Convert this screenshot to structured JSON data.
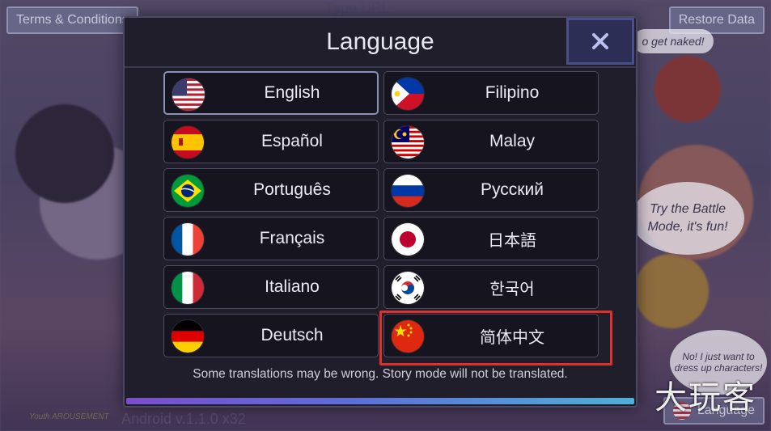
{
  "background": {
    "terms_button": "Terms & Conditions",
    "restore_button": "Restore Data",
    "language_button": "Language",
    "type_url_text": "Type URL:",
    "bubble_naked": "o get naked!",
    "bubble_battle": "Try the Battle Mode, it's fun!",
    "bubble_dress": "No! I just want to dress up characters!",
    "version_text": "Android v.1.1.0 x32",
    "studio_text": "Youth AROUSEMENT"
  },
  "modal": {
    "title": "Language",
    "close_icon": "close-icon",
    "note": "Some translations may be wrong. Story mode will not be translated.",
    "languages": [
      {
        "label": "English",
        "flag": "us-flag-icon",
        "selected": true
      },
      {
        "label": "Filipino",
        "flag": "philippines-flag-icon"
      },
      {
        "label": "Español",
        "flag": "spain-flag-icon"
      },
      {
        "label": "Malay",
        "flag": "malaysia-flag-icon"
      },
      {
        "label": "Português",
        "flag": "brazil-flag-icon"
      },
      {
        "label": "Русский",
        "flag": "russia-flag-icon"
      },
      {
        "label": "Français",
        "flag": "france-flag-icon"
      },
      {
        "label": "日本語",
        "flag": "japan-flag-icon"
      },
      {
        "label": "Italiano",
        "flag": "italy-flag-icon"
      },
      {
        "label": "한국어",
        "flag": "korea-flag-icon"
      },
      {
        "label": "Deutsch",
        "flag": "germany-flag-icon"
      },
      {
        "label": "简体中文",
        "flag": "china-flag-icon",
        "highlighted": true
      }
    ]
  },
  "watermark": "大玩客",
  "colors": {
    "highlight": "#e0302a",
    "modal_bg": "#1f1e2a",
    "button_bg": "#16151f",
    "close_bg": "#2c2e55"
  }
}
